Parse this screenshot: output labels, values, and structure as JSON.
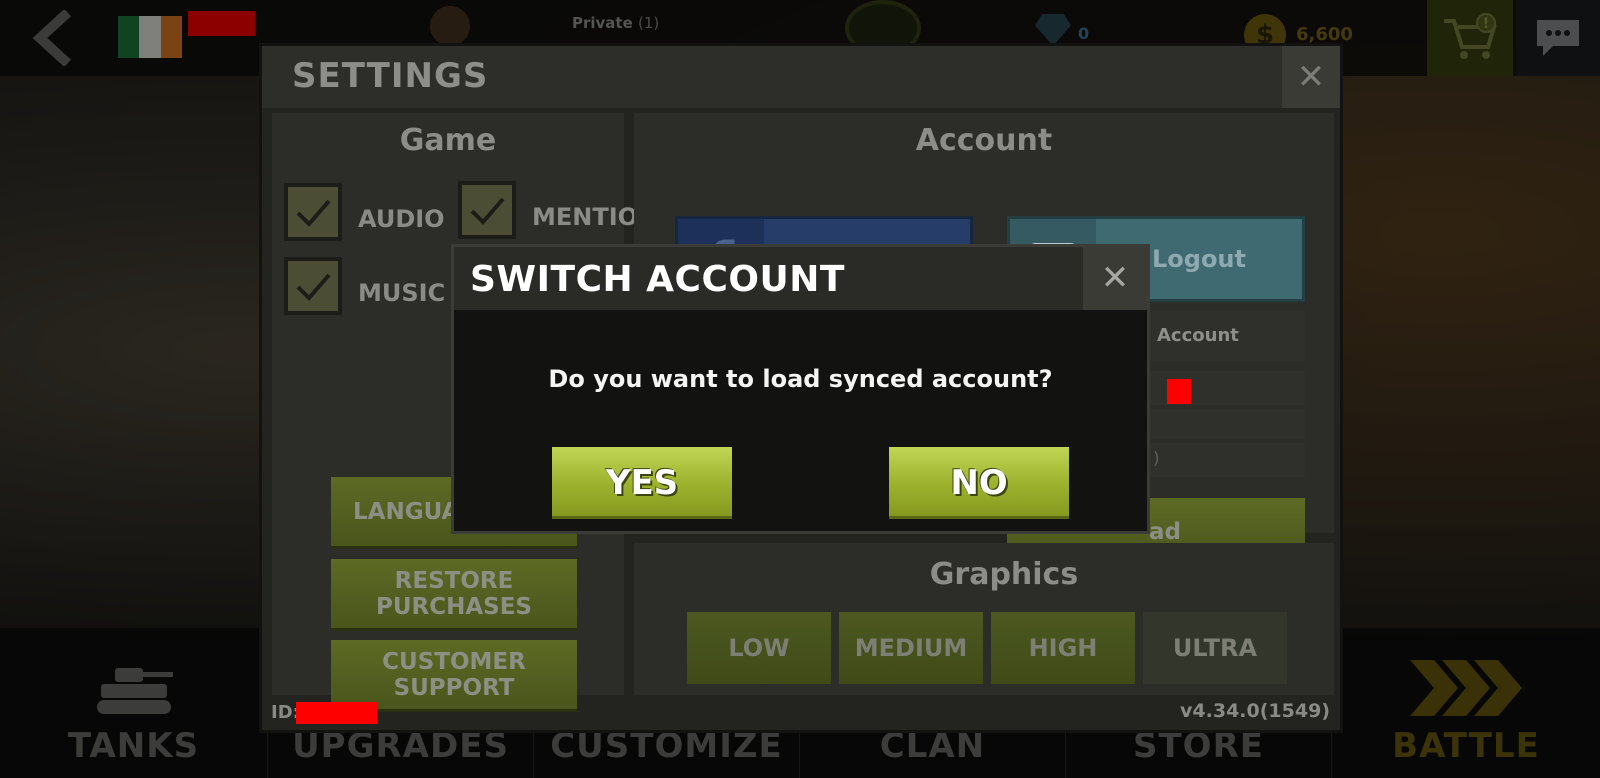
{
  "topbar": {
    "rank_name": "Private",
    "rank_count": "(1)",
    "gems": "0",
    "coins": "6,600"
  },
  "bottom_nav": {
    "items": [
      {
        "label": "TANKS"
      },
      {
        "label": "UPGRADES"
      },
      {
        "label": "CUSTOMIZE"
      },
      {
        "label": "CLAN"
      },
      {
        "label": "STORE"
      },
      {
        "label": "BATTLE"
      }
    ]
  },
  "settings": {
    "title": "SETTINGS",
    "game": {
      "title": "Game",
      "checkboxes": [
        {
          "label": "AUDIO",
          "checked": true
        },
        {
          "label": "MENTION",
          "checked": true
        },
        {
          "label": "MUSIC",
          "checked": true
        }
      ],
      "buttons": [
        "LANGUAGE",
        "RESTORE PURCHASES",
        "CUSTOMER SUPPORT"
      ]
    },
    "account": {
      "title": "Account",
      "facebook_logout": "Logout",
      "google_logout": "Logout",
      "row_account": "Account",
      "row_partial": ")",
      "load_button_partial": "ad"
    },
    "graphics": {
      "title": "Graphics",
      "options": [
        "LOW",
        "MEDIUM",
        "HIGH",
        "ULTRA"
      ],
      "selected": "ULTRA"
    },
    "footer": {
      "id_label": "ID:",
      "version": "v4.34.0(1549)"
    }
  },
  "modal": {
    "title": "SWITCH ACCOUNT",
    "message": "Do you want to load synced account?",
    "yes": "YES",
    "no": "NO"
  },
  "colors": {
    "accent": "#a4b93a",
    "facebook": "#263d6a",
    "google": "#3f6a72",
    "redaction": "#ff0000"
  }
}
